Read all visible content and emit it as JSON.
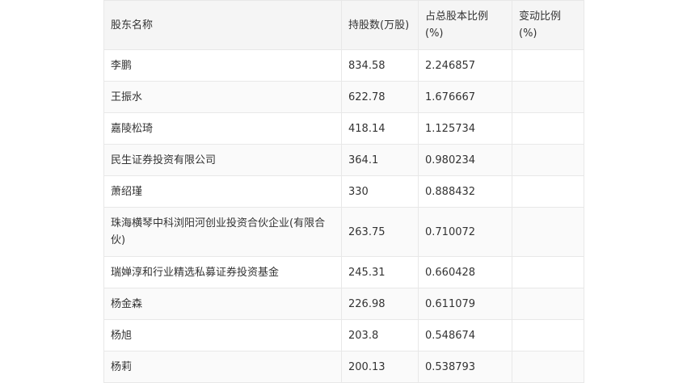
{
  "table": {
    "headers": [
      "股东名称",
      "持股数(万股)",
      "占总股本比例(%)",
      "变动比例(%)"
    ],
    "rows": [
      {
        "name": "李鹏",
        "shares": "834.58",
        "ratio": "2.246857",
        "change": ""
      },
      {
        "name": "王振水",
        "shares": "622.78",
        "ratio": "1.676667",
        "change": ""
      },
      {
        "name": "嘉陵松琦",
        "shares": "418.14",
        "ratio": "1.125734",
        "change": ""
      },
      {
        "name": "民生证券投资有限公司",
        "shares": "364.1",
        "ratio": "0.980234",
        "change": ""
      },
      {
        "name": "萧绍瑾",
        "shares": "330",
        "ratio": "0.888432",
        "change": ""
      },
      {
        "name": "珠海横琴中科浏阳河创业投资合伙企业(有限合伙)",
        "shares": "263.75",
        "ratio": "0.710072",
        "change": ""
      },
      {
        "name": "瑞婵淳和行业精选私募证券投资基金",
        "shares": "245.31",
        "ratio": "0.660428",
        "change": ""
      },
      {
        "name": "杨金森",
        "shares": "226.98",
        "ratio": "0.611079",
        "change": ""
      },
      {
        "name": "杨旭",
        "shares": "203.8",
        "ratio": "0.548674",
        "change": ""
      },
      {
        "name": "杨莉",
        "shares": "200.13",
        "ratio": "0.538793",
        "change": ""
      }
    ]
  }
}
